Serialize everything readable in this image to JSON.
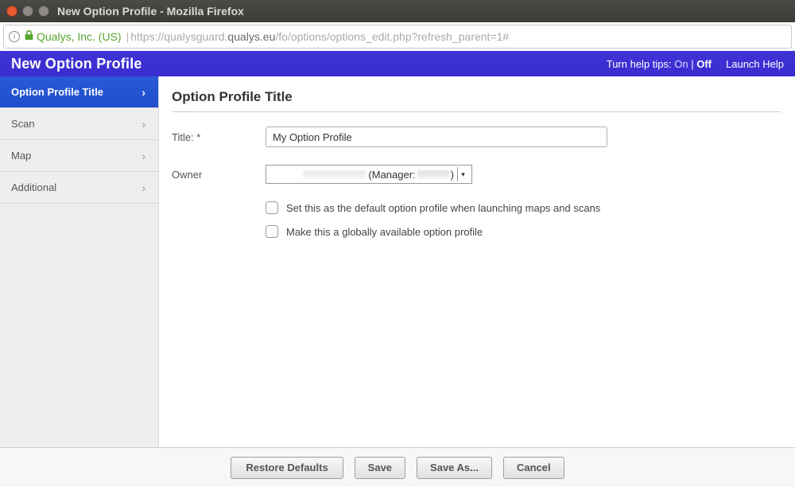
{
  "os": {
    "window_title": "New Option Profile - Mozilla Firefox"
  },
  "urlbar": {
    "org": "Qualys, Inc. (US)",
    "url_pre": "https://qualysguard.",
    "url_host": "qualys.eu",
    "url_post": "/fo/options/options_edit.php?refresh_parent=1#"
  },
  "header": {
    "title": "New Option Profile",
    "help_tips_label": "Turn help tips:",
    "on": "On",
    "sep": " | ",
    "off": "Off",
    "launch": "Launch Help"
  },
  "sidebar": {
    "items": [
      {
        "label": "Option Profile Title"
      },
      {
        "label": "Scan"
      },
      {
        "label": "Map"
      },
      {
        "label": "Additional"
      }
    ]
  },
  "content": {
    "heading": "Option Profile Title",
    "title_label": "Title: *",
    "title_value": "My Option Profile",
    "owner_label": "Owner",
    "owner_display": "(Manager:            )",
    "default_option_label": "Set this as the default option profile when launching maps and scans",
    "global_option_label": "Make this a globally available option profile"
  },
  "footer": {
    "restore": "Restore Defaults",
    "save": "Save",
    "saveas": "Save As...",
    "cancel": "Cancel"
  }
}
